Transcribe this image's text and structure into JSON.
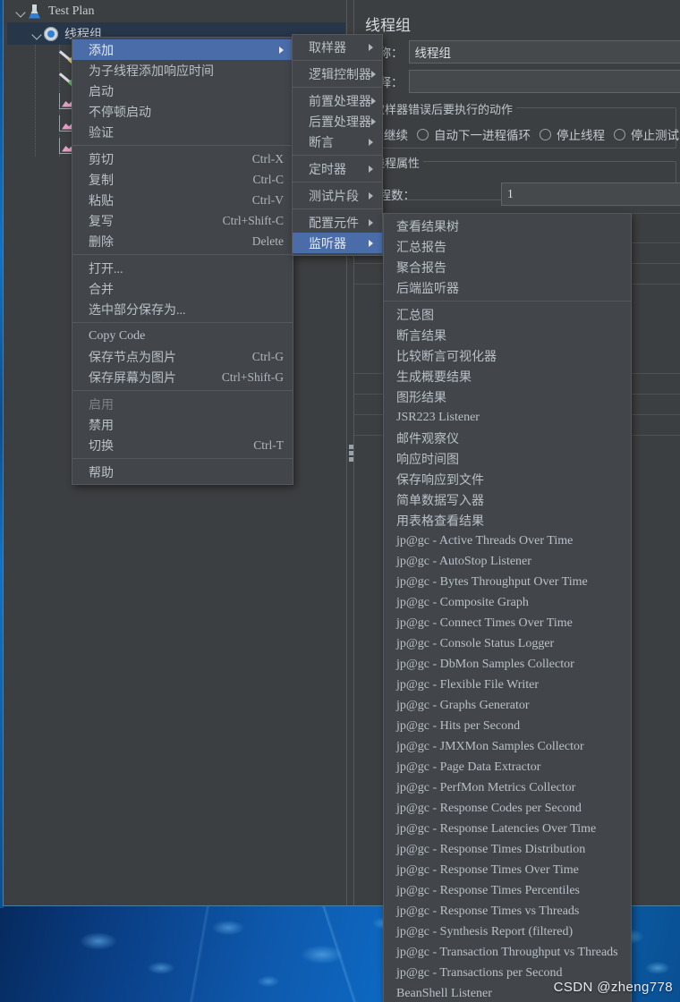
{
  "window": {
    "tree": {
      "nodes": [
        {
          "label": "Test Plan",
          "icon": "flask-icon",
          "indent": 8,
          "expanded": true,
          "selected": false
        },
        {
          "label": "线程组",
          "icon": "gear-icon",
          "indent": 26,
          "expanded": true,
          "selected": true
        },
        {
          "label": "",
          "icon": "sampler-icon",
          "indent": 58,
          "expanded": false,
          "selected": false
        },
        {
          "label": "",
          "icon": "preprocessor-icon",
          "indent": 58,
          "expanded": false,
          "selected": false
        },
        {
          "label": "",
          "icon": "listener-icon",
          "indent": 58,
          "expanded": false,
          "selected": false
        },
        {
          "label": "",
          "icon": "listener-icon",
          "indent": 58,
          "expanded": false,
          "selected": false
        },
        {
          "label": "",
          "icon": "listener-icon",
          "indent": 58,
          "expanded": false,
          "selected": false
        }
      ]
    },
    "config": {
      "title": "线程组",
      "name_label": "名称：",
      "name_value": "线程组",
      "comment_label": "注释：",
      "comment_value": "",
      "error_action_legend": "取样器错误后要执行的动作",
      "error_actions": [
        {
          "label": "继续",
          "selected": true
        },
        {
          "label": "自动下一进程循环",
          "selected": false
        },
        {
          "label": "停止线程",
          "selected": false
        },
        {
          "label": "停止测试",
          "selected": false
        },
        {
          "label": "",
          "selected": false
        }
      ],
      "thread_props_legend": "线程属性",
      "thread_count_label": "线程数：",
      "thread_count_value": "1"
    },
    "context_menu": {
      "items": [
        {
          "label": "添加",
          "accel": "",
          "submenu": true,
          "highlighted": true,
          "disabled": false
        },
        {
          "separator": false,
          "label": "为子线程添加响应时间",
          "accel": "",
          "submenu": false,
          "highlighted": false,
          "disabled": false
        },
        {
          "label": "启动",
          "accel": "",
          "submenu": false,
          "highlighted": false,
          "disabled": false
        },
        {
          "label": "不停顿启动",
          "accel": "",
          "submenu": false,
          "highlighted": false,
          "disabled": false
        },
        {
          "label": "验证",
          "accel": "",
          "submenu": false,
          "highlighted": false,
          "disabled": false
        },
        {
          "separator": true
        },
        {
          "label": "剪切",
          "accel": "Ctrl-X",
          "submenu": false,
          "highlighted": false,
          "disabled": false
        },
        {
          "label": "复制",
          "accel": "Ctrl-C",
          "submenu": false,
          "highlighted": false,
          "disabled": false
        },
        {
          "label": "粘贴",
          "accel": "Ctrl-V",
          "submenu": false,
          "highlighted": false,
          "disabled": false
        },
        {
          "label": "复写",
          "accel": "Ctrl+Shift-C",
          "submenu": false,
          "highlighted": false,
          "disabled": false
        },
        {
          "label": "删除",
          "accel": "Delete",
          "submenu": false,
          "highlighted": false,
          "disabled": false
        },
        {
          "separator": true
        },
        {
          "label": "打开...",
          "accel": "",
          "submenu": false,
          "highlighted": false,
          "disabled": false
        },
        {
          "label": "合并",
          "accel": "",
          "submenu": false,
          "highlighted": false,
          "disabled": false
        },
        {
          "label": "选中部分保存为...",
          "accel": "",
          "submenu": false,
          "highlighted": false,
          "disabled": false
        },
        {
          "separator": true
        },
        {
          "label": "Copy Code",
          "accel": "",
          "submenu": false,
          "highlighted": false,
          "disabled": false
        },
        {
          "label": "保存节点为图片",
          "accel": "Ctrl-G",
          "submenu": false,
          "highlighted": false,
          "disabled": false
        },
        {
          "label": "保存屏幕为图片",
          "accel": "Ctrl+Shift-G",
          "submenu": false,
          "highlighted": false,
          "disabled": false
        },
        {
          "separator": true
        },
        {
          "label": "启用",
          "accel": "",
          "submenu": false,
          "highlighted": false,
          "disabled": true
        },
        {
          "label": "禁用",
          "accel": "",
          "submenu": false,
          "highlighted": false,
          "disabled": false
        },
        {
          "label": "切换",
          "accel": "Ctrl-T",
          "submenu": false,
          "highlighted": false,
          "disabled": false
        },
        {
          "separator": true
        },
        {
          "label": "帮助",
          "accel": "",
          "submenu": false,
          "highlighted": false,
          "disabled": false
        }
      ]
    },
    "add_menu": {
      "items": [
        {
          "label": "取样器",
          "submenu": true,
          "highlighted": false
        },
        {
          "separator": true
        },
        {
          "label": "逻辑控制器",
          "submenu": true,
          "highlighted": false
        },
        {
          "separator": true
        },
        {
          "label": "前置处理器",
          "submenu": true,
          "highlighted": false
        },
        {
          "label": "后置处理器",
          "submenu": true,
          "highlighted": false
        },
        {
          "label": "断言",
          "submenu": true,
          "highlighted": false
        },
        {
          "separator": true
        },
        {
          "label": "定时器",
          "submenu": true,
          "highlighted": false
        },
        {
          "separator": true
        },
        {
          "label": "测试片段",
          "submenu": true,
          "highlighted": false
        },
        {
          "separator": true
        },
        {
          "label": "配置元件",
          "submenu": true,
          "highlighted": false
        },
        {
          "label": "监听器",
          "submenu": true,
          "highlighted": true
        }
      ]
    },
    "listener_menu": {
      "items": [
        {
          "label": "查看结果树"
        },
        {
          "label": "汇总报告"
        },
        {
          "label": "聚合报告"
        },
        {
          "label": "后端监听器"
        },
        {
          "separator": true
        },
        {
          "label": "汇总图"
        },
        {
          "label": "断言结果"
        },
        {
          "label": "比较断言可视化器"
        },
        {
          "label": "生成概要结果"
        },
        {
          "label": "图形结果"
        },
        {
          "label": "JSR223 Listener"
        },
        {
          "label": "邮件观察仪"
        },
        {
          "label": "响应时间图"
        },
        {
          "label": "保存响应到文件"
        },
        {
          "label": "简单数据写入器"
        },
        {
          "label": "用表格查看结果"
        },
        {
          "label": "jp@gc - Active Threads Over Time"
        },
        {
          "label": "jp@gc - AutoStop Listener"
        },
        {
          "label": "jp@gc - Bytes Throughput Over Time"
        },
        {
          "label": "jp@gc - Composite Graph"
        },
        {
          "label": "jp@gc - Connect Times Over Time"
        },
        {
          "label": "jp@gc - Console Status Logger"
        },
        {
          "label": "jp@gc - DbMon Samples Collector"
        },
        {
          "label": "jp@gc - Flexible File Writer"
        },
        {
          "label": "jp@gc - Graphs Generator"
        },
        {
          "label": "jp@gc - Hits per Second"
        },
        {
          "label": "jp@gc - JMXMon Samples Collector"
        },
        {
          "label": "jp@gc - Page Data Extractor"
        },
        {
          "label": "jp@gc - PerfMon Metrics Collector"
        },
        {
          "label": "jp@gc - Response Codes per Second"
        },
        {
          "label": "jp@gc - Response Latencies Over Time"
        },
        {
          "label": "jp@gc - Response Times Distribution"
        },
        {
          "label": "jp@gc - Response Times Over Time"
        },
        {
          "label": "jp@gc - Response Times Percentiles"
        },
        {
          "label": "jp@gc - Response Times vs Threads"
        },
        {
          "label": "jp@gc - Synthesis Report (filtered)"
        },
        {
          "label": "jp@gc - Transaction Throughput vs Threads"
        },
        {
          "label": "jp@gc - Transactions per Second"
        },
        {
          "label": "BeanShell Listener"
        }
      ]
    }
  },
  "watermark": "CSDN @zheng778",
  "colors": {
    "panel_bg": "#3c3f41",
    "menu_bg": "#42464a",
    "menu_highlight": "#4a6ca8",
    "tree_selected": "#28364a",
    "text": "#b9c0c7",
    "desktop_blue": "#0d6cc6"
  }
}
